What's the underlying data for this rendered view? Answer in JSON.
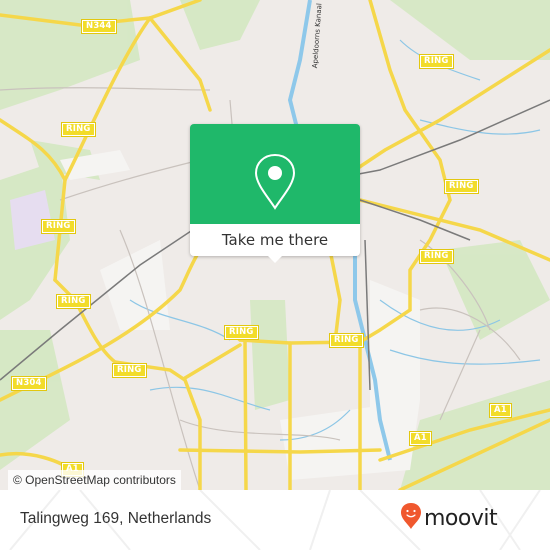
{
  "map": {
    "road_labels": [
      {
        "id": "n344",
        "text": "N344"
      },
      {
        "id": "ring-nw",
        "text": "RING"
      },
      {
        "id": "ring-w1",
        "text": "RING"
      },
      {
        "id": "ring-w2",
        "text": "RING"
      },
      {
        "id": "ring-sw",
        "text": "RING"
      },
      {
        "id": "ring-s1",
        "text": "RING"
      },
      {
        "id": "ring-s2",
        "text": "RING"
      },
      {
        "id": "ring-ne",
        "text": "RING"
      },
      {
        "id": "ring-e1",
        "text": "RING"
      },
      {
        "id": "ring-e2",
        "text": "RING"
      },
      {
        "id": "n304",
        "text": "N304"
      },
      {
        "id": "a1-1",
        "text": "A1"
      },
      {
        "id": "a1-2",
        "text": "A1"
      },
      {
        "id": "a1-3",
        "text": "A1"
      }
    ],
    "canal_label": "Apeldoorns Kanaal",
    "attribution": "© OpenStreetMap contributors"
  },
  "popup": {
    "icon": "location-pin-icon",
    "button_label": "Take me there",
    "color": "#1fb86a"
  },
  "footer": {
    "address": "Talingweg 169, Netherlands",
    "logo_text": "moovit",
    "logo_color": "#f0582e"
  }
}
